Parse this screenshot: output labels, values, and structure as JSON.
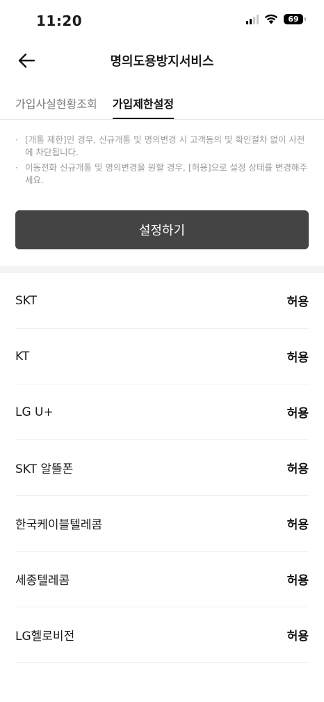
{
  "status_bar": {
    "time": "11:20",
    "battery": "69",
    "icons": [
      "signal-icon",
      "wifi-icon",
      "battery-icon"
    ]
  },
  "header": {
    "title": "명의도용방지서비스",
    "back_icon": "back-arrow-icon"
  },
  "tabs": [
    {
      "label": "가입사실현황조회",
      "active": false
    },
    {
      "label": "가입제한설정",
      "active": true
    }
  ],
  "notes": [
    "[개통 제한]인 경우, 신규개통 및 명의변경 시 고객동의 및 확인절차 없이 사전에 차단됩니다.",
    "이동전화 신규개통 및 명의변경을 원할 경우, [허용]으로 설정 상태를 변경해주세요."
  ],
  "settings_button": {
    "label": "설정하기"
  },
  "carriers": [
    {
      "name": "SKT",
      "status": "허용"
    },
    {
      "name": "KT",
      "status": "허용"
    },
    {
      "name": "LG U+",
      "status": "허용"
    },
    {
      "name": "SKT 알뜰폰",
      "status": "허용"
    },
    {
      "name": "한국케이블텔레콤",
      "status": "허용"
    },
    {
      "name": "세종텔레콤",
      "status": "허용"
    },
    {
      "name": "LG헬로비전",
      "status": "허용"
    }
  ],
  "colors": {
    "button_bg": "#444444",
    "note_text": "#9b9b9b",
    "inactive_tab": "#7a7a7a"
  }
}
